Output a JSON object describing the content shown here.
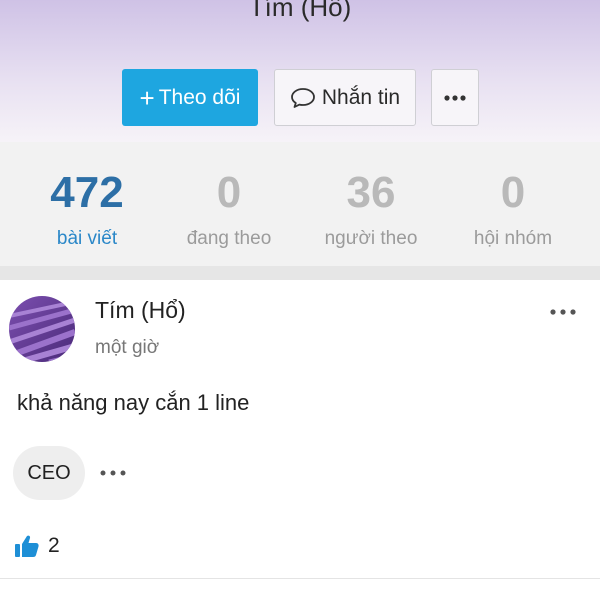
{
  "header": {
    "profile_name": "Tím (Hổ)",
    "follow_label": "Theo dõi",
    "message_label": "Nhắn tin",
    "more_icon": "more-horizontal-icon"
  },
  "stats": [
    {
      "value": "472",
      "label": "bài viết",
      "active": true
    },
    {
      "value": "0",
      "label": "đang theo",
      "active": false
    },
    {
      "value": "36",
      "label": "người theo",
      "active": false
    },
    {
      "value": "0",
      "label": "hội nhóm",
      "active": false
    }
  ],
  "post": {
    "author": "Tím (Hổ)",
    "time": "một giờ",
    "text": "khả năng nay cắn 1 line",
    "tag": "CEO",
    "like_count": "2"
  },
  "colors": {
    "accent": "#1ea6e0",
    "active_stat": "#2d6fa6"
  }
}
